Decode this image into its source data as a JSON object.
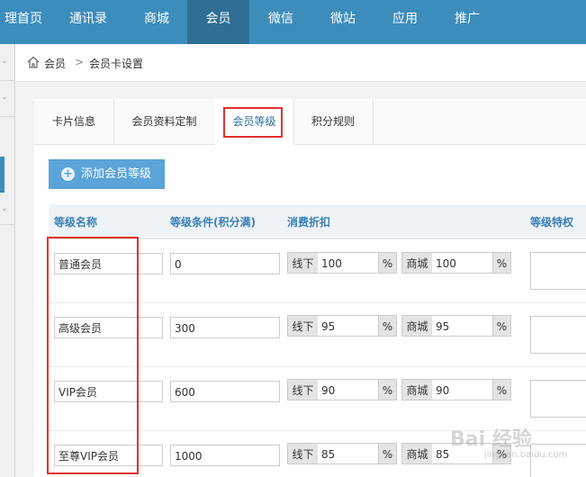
{
  "topnav": {
    "items": [
      "理首页",
      "通讯录",
      "商城",
      "会员",
      "微信",
      "微站",
      "应用",
      "推广"
    ],
    "active": "会员"
  },
  "breadcrumb": {
    "home_icon": "home-icon",
    "level1": "会员",
    "separator": ">",
    "level2": "会员卡设置"
  },
  "tabs": [
    "卡片信息",
    "会员资料定制",
    "会员等级",
    "积分规则"
  ],
  "active_tab": "会员等级",
  "add_button": {
    "icon": "plus-circle-icon",
    "label": "添加会员等级"
  },
  "table": {
    "headers": {
      "name": "等级名称",
      "condition": "等级条件(积分满)",
      "discount": "消费折扣",
      "privilege": "等级特权"
    },
    "offline_label": "线下",
    "mall_label": "商城",
    "percent": "%",
    "rows": [
      {
        "name": "普通会员",
        "points": "0",
        "offline": "100",
        "mall": "100"
      },
      {
        "name": "高级会员",
        "points": "300",
        "offline": "95",
        "mall": "95"
      },
      {
        "name": "VIP会员",
        "points": "600",
        "offline": "90",
        "mall": "90"
      },
      {
        "name": "至尊VIP会员",
        "points": "1000",
        "offline": "85",
        "mall": "85"
      }
    ]
  },
  "highlight_color": "#e0322d",
  "watermark": {
    "text": "Bai 经验",
    "sub": "jingyan.baidu.com"
  }
}
